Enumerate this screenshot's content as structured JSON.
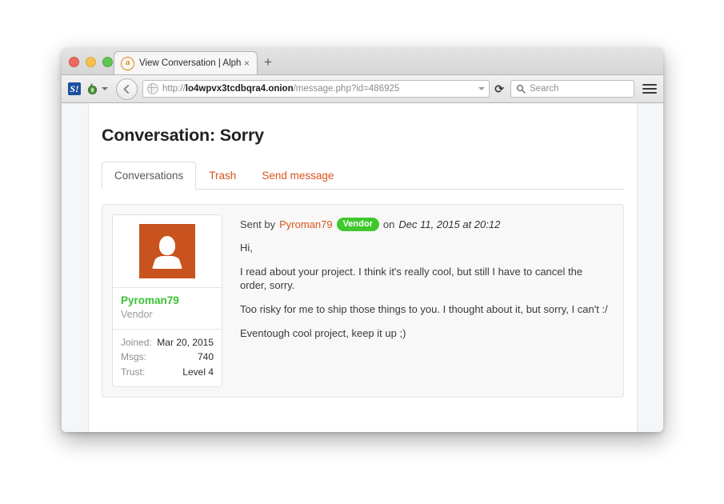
{
  "browser": {
    "traffic_lights": [
      "close",
      "minimize",
      "zoom"
    ],
    "tab": {
      "favicon_letter": "a",
      "title": "View Conversation | Alphab…",
      "close_label": "×"
    },
    "new_tab_label": "+",
    "toolbar": {
      "stumbleupon_label": "S!",
      "back_label": "←",
      "reload_label": "⟳",
      "url_scheme": "http://",
      "url_host": "lo4wpvx3tcdbqra4.onion",
      "url_path": "/message.php?id=486925",
      "search_placeholder": "Search",
      "menu_label": "menu"
    }
  },
  "page": {
    "title": "Conversation: Sorry",
    "tabs": [
      {
        "label": "Conversations",
        "active": true
      },
      {
        "label": "Trash",
        "active": false
      },
      {
        "label": "Send message",
        "active": false
      }
    ],
    "profile": {
      "name": "Pyroman79",
      "role": "Vendor",
      "stats": [
        {
          "label": "Joined:",
          "value": "Mar 20, 2015"
        },
        {
          "label": "Msgs:",
          "value": "740"
        },
        {
          "label": "Trust:",
          "value": "Level 4"
        }
      ]
    },
    "message": {
      "sent_by_prefix": "Sent by",
      "sender": "Pyroman79",
      "badge": "Vendor",
      "on_label": "on",
      "date": "Dec 11, 2015 at 20:12",
      "lines": [
        "Hi,",
        "I read about your project. I think it's really cool, but still I have to cancel the order, sorry.",
        "Too risky for me to ship those things to you. I thought about it, but sorry, I can't :/",
        "Eventough cool project, keep it up ;)"
      ]
    }
  },
  "colors": {
    "accent_orange": "#d9541e",
    "avatar_orange": "#c8531e",
    "vendor_green": "#3fc72c",
    "name_green": "#3cc234"
  }
}
